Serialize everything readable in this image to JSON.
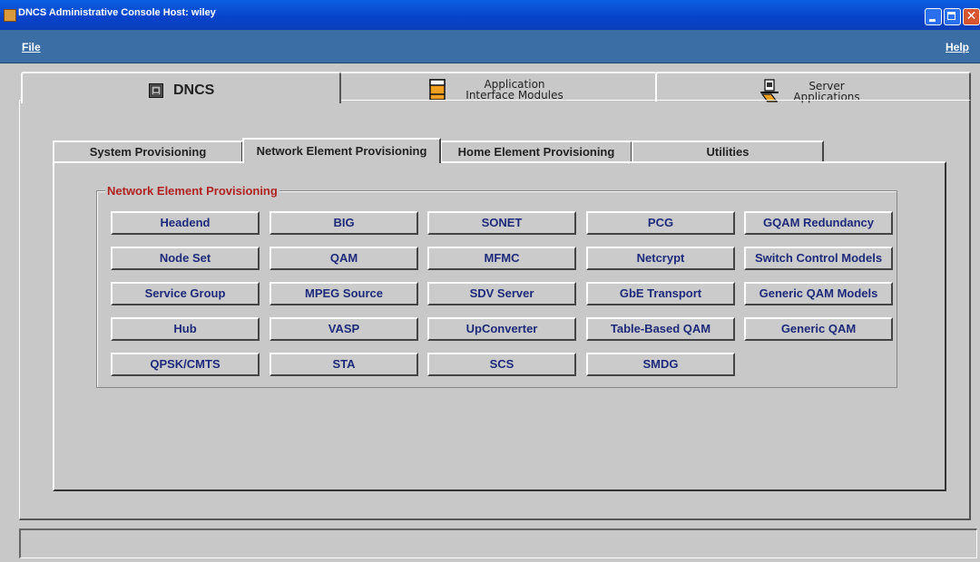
{
  "window": {
    "title": "DNCS Administrative Console  Host:  wiley",
    "controls": [
      "minimize-icon",
      "maximize-icon",
      "close-icon"
    ],
    "colors": {
      "titlebar": "#0842c9",
      "menubar": "#3a6ea5",
      "background": "#c8c8c8",
      "button_text": "#1d2a7a",
      "group_label": "#b22222"
    }
  },
  "menu": {
    "file": "File",
    "help": "Help"
  },
  "top_tabs": [
    {
      "label": "DNCS",
      "icon": "dncs-monitor-icon",
      "active": true
    },
    {
      "label_line1": "Application",
      "label_line2": "Interface Modules",
      "icon": "aim-module-icon",
      "active": false
    },
    {
      "label_line1": "Server",
      "label_line2": "Applications",
      "icon": "server-applications-icon",
      "active": false
    }
  ],
  "sub_tabs": [
    {
      "label": "System Provisioning",
      "active": false
    },
    {
      "label": "Network Element Provisioning",
      "active": true
    },
    {
      "label": "Home Element Provisioning",
      "active": false
    },
    {
      "label": "Utilities",
      "active": false
    }
  ],
  "group": {
    "title": "Network Element Provisioning",
    "buttons": [
      [
        "Headend",
        "BIG",
        "SONET",
        "PCG",
        "GQAM Redundancy"
      ],
      [
        "Node Set",
        "QAM",
        "MFMC",
        "Netcrypt",
        "Switch Control Models"
      ],
      [
        "Service Group",
        "MPEG Source",
        "SDV Server",
        "GbE Transport",
        "Generic QAM Models"
      ],
      [
        "Hub",
        "VASP",
        "UpConverter",
        "Table-Based QAM",
        "Generic QAM"
      ],
      [
        "QPSK/CMTS",
        "STA",
        "SCS",
        "SMDG"
      ]
    ]
  },
  "status": {
    "text": ""
  }
}
